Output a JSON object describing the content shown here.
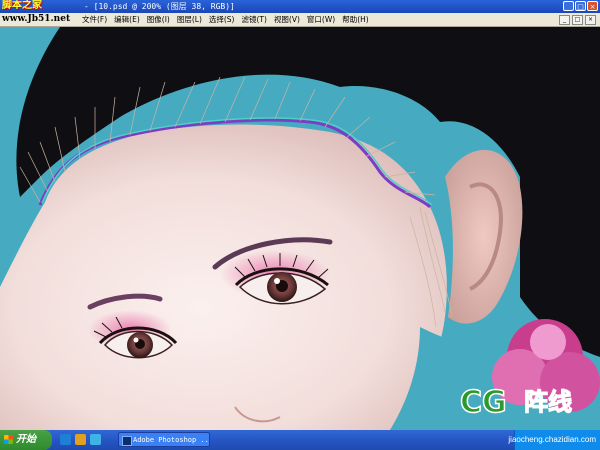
{
  "window": {
    "site_mark": "脚本之家",
    "title": "- [10.psd @ 200% (图层 38, RGB)]",
    "controls": {
      "minimize": "_",
      "maximize": "□",
      "close": "×"
    }
  },
  "menubar": {
    "site_url": "www.Jb51.net",
    "items": [
      "文件(F)",
      "编辑(E)",
      "图像(I)",
      "图层(L)",
      "选择(S)",
      "滤镜(T)",
      "视图(V)",
      "窗口(W)",
      "帮助(H)"
    ]
  },
  "logo": {
    "cg": "CG",
    "brand": "阵线"
  },
  "taskbar": {
    "start_label": "开始",
    "task_item": "Adobe Photoshop ...",
    "watermark_url": "jiaocheng.chazidian.com"
  },
  "colors": {
    "background": "#46aac0",
    "skin": "#f5e6e4",
    "hair": "#101014",
    "eyeshadow": "#e07aa8",
    "path_accent": "#7c3cc4",
    "path_cyan": "#4fd0c8",
    "logo_green": "#2a9a2a",
    "logo_red": "#d0201a"
  },
  "icons": [
    "minimize-icon",
    "maximize-icon",
    "close-icon",
    "windows-flag-icon",
    "photoshop-task-icon"
  ]
}
